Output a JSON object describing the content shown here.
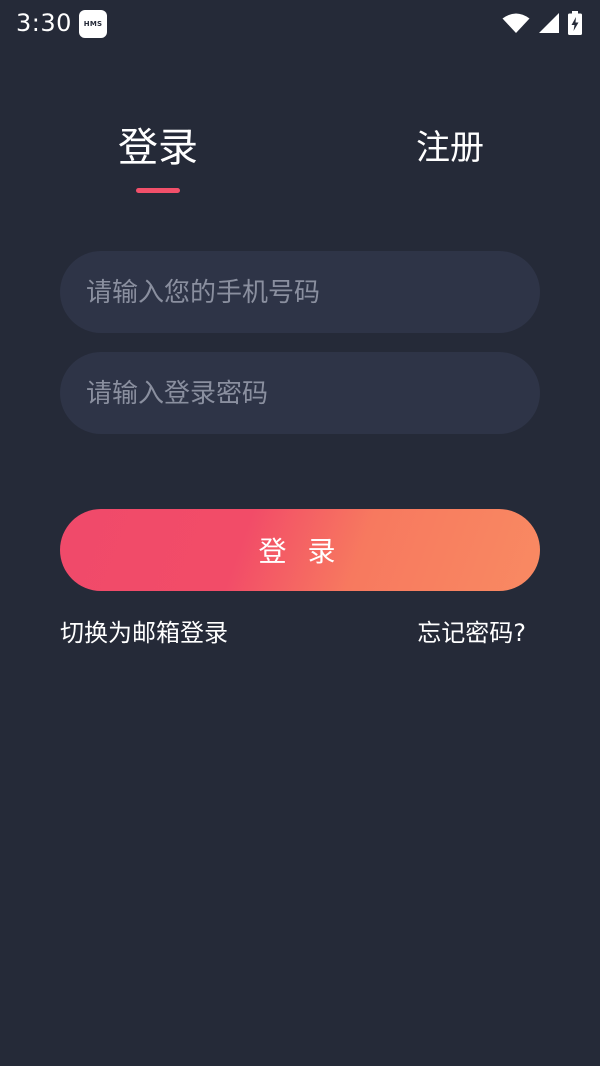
{
  "status_bar": {
    "time": "3:30",
    "badge": "HMS",
    "icons": [
      "wifi-icon",
      "cellular-signal-icon",
      "battery-charging-icon"
    ]
  },
  "tabs": {
    "login": "登录",
    "register": "注册",
    "active": "login"
  },
  "form": {
    "phone_placeholder": "请输入您的手机号码",
    "phone_value": "",
    "password_placeholder": "请输入登录密码",
    "password_value": ""
  },
  "login_button": "登 录",
  "links": {
    "switch_email": "切换为邮箱登录",
    "forgot_password": "忘记密码?"
  },
  "colors": {
    "background": "#252a38",
    "field_background": "#2e3447",
    "accent": "#f2506a",
    "gradient_end": "#f98a62"
  }
}
